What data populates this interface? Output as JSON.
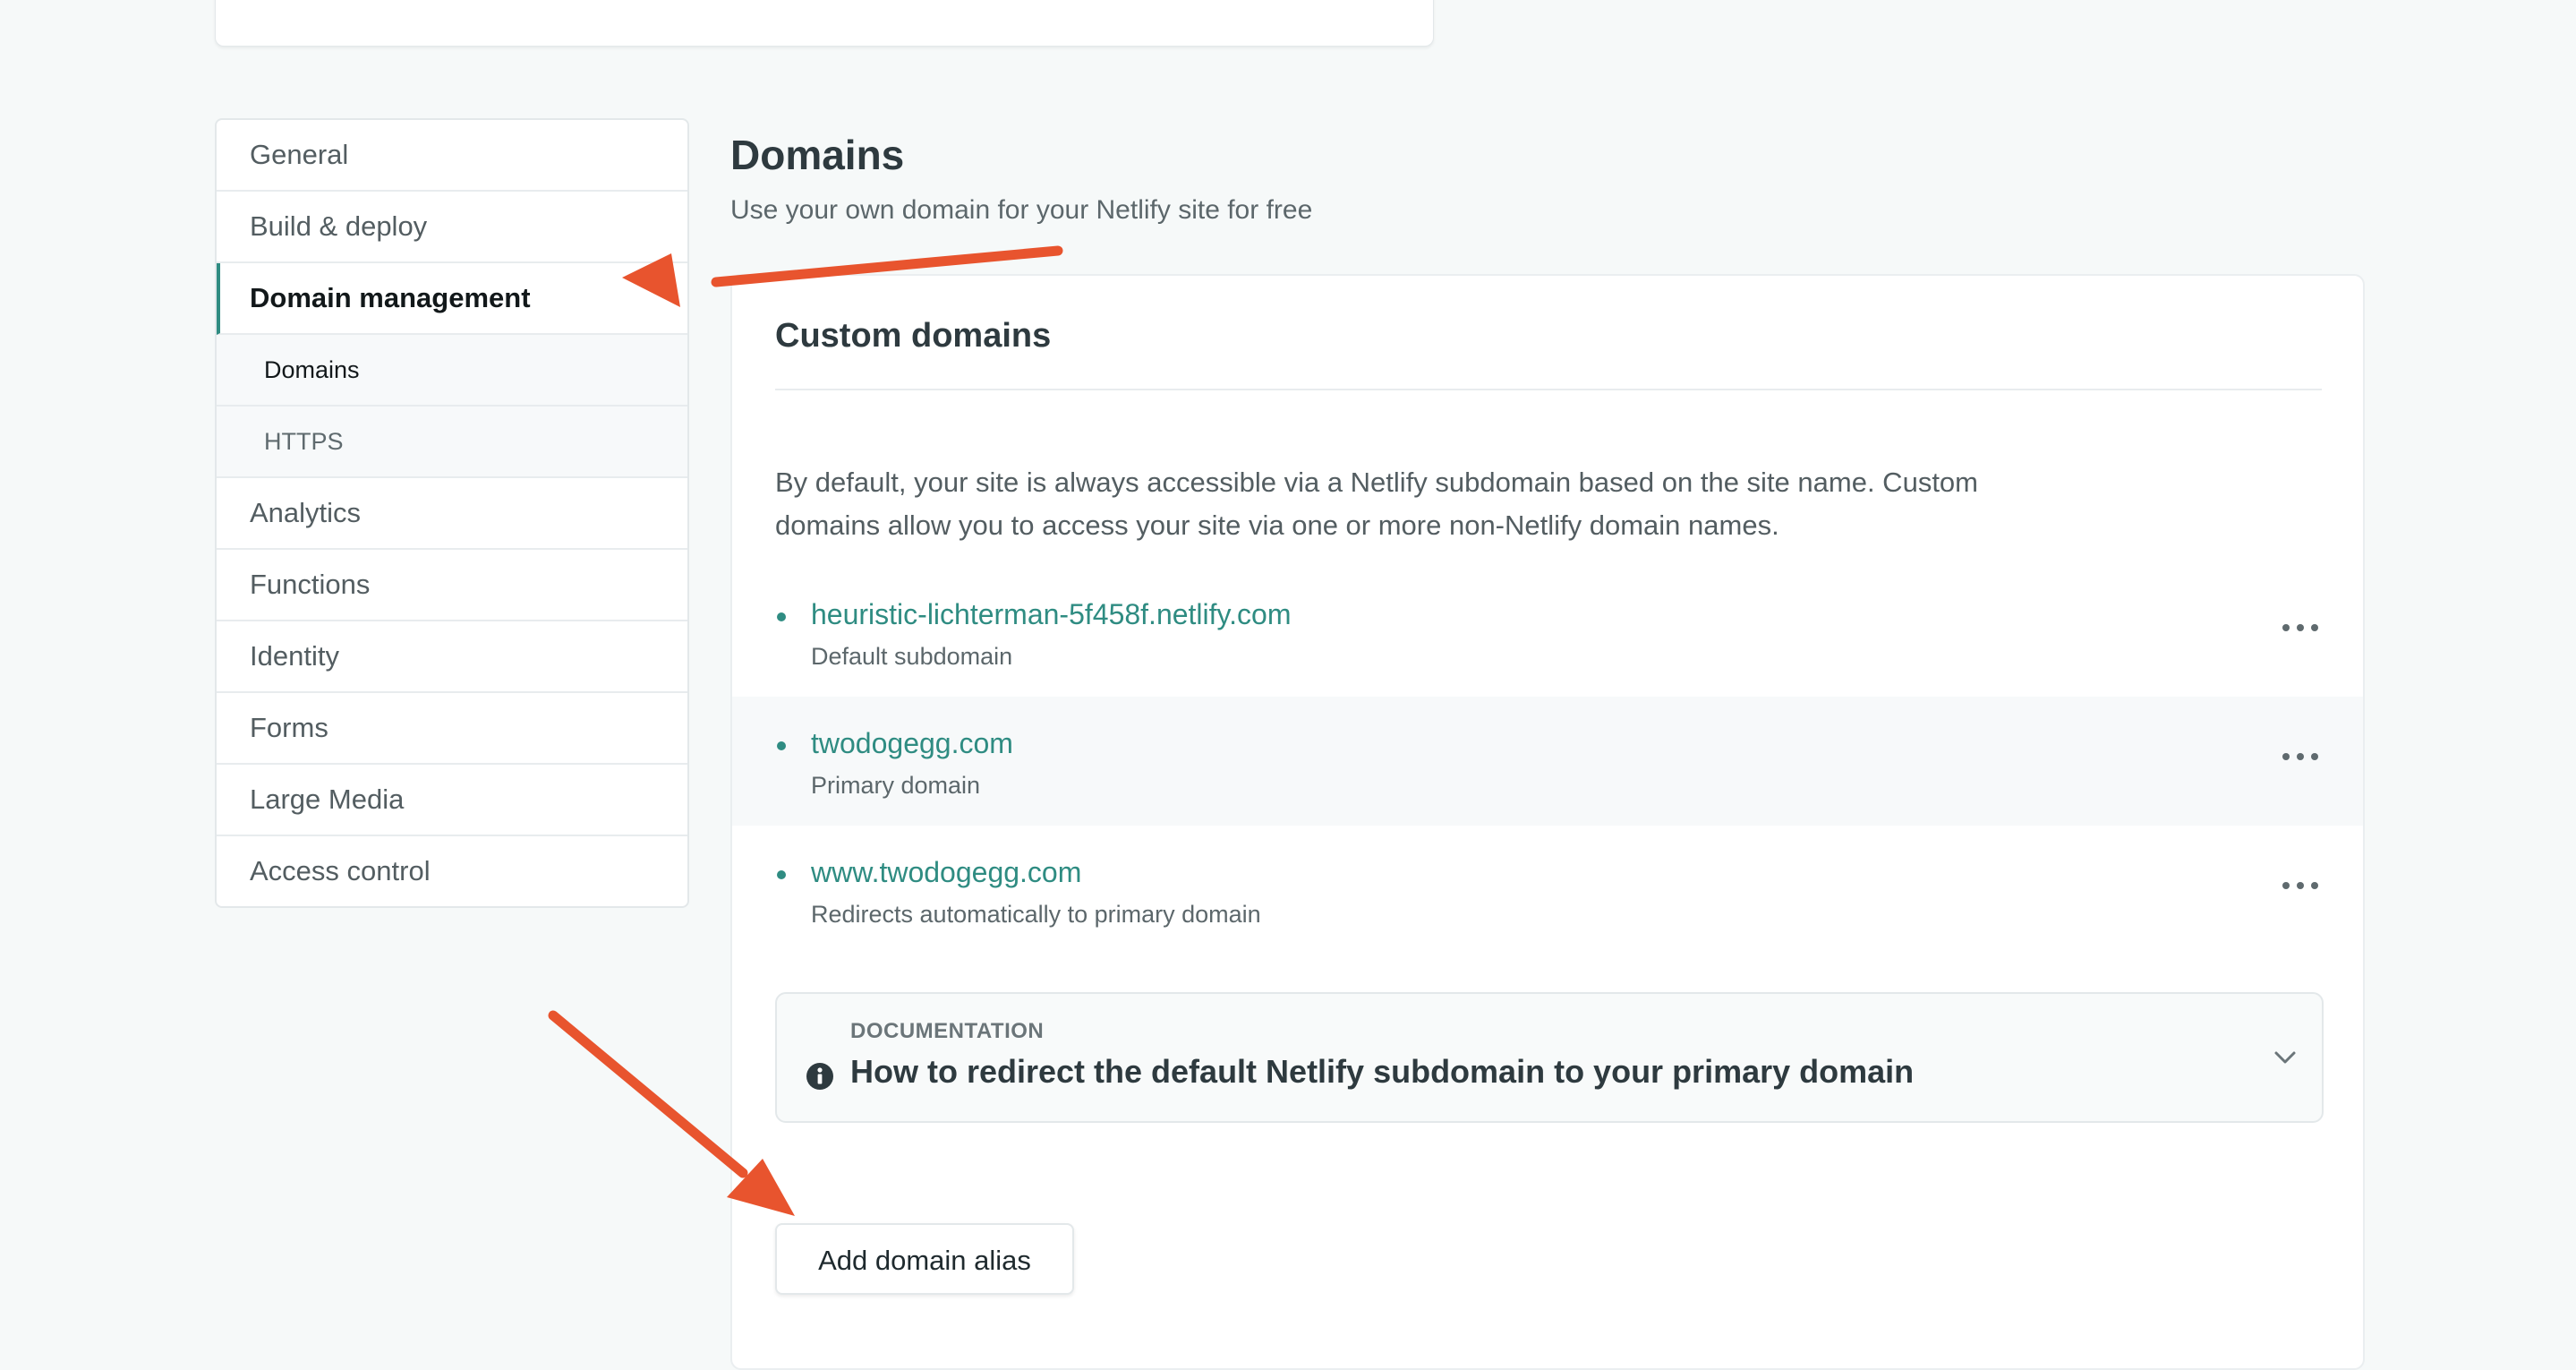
{
  "sidebar": {
    "items": [
      {
        "label": "General"
      },
      {
        "label": "Build & deploy"
      },
      {
        "label": "Domain management"
      },
      {
        "label": "Analytics"
      },
      {
        "label": "Functions"
      },
      {
        "label": "Identity"
      },
      {
        "label": "Forms"
      },
      {
        "label": "Large Media"
      },
      {
        "label": "Access control"
      }
    ],
    "subitems": [
      {
        "label": "Domains"
      },
      {
        "label": "HTTPS"
      }
    ]
  },
  "page": {
    "title": "Domains",
    "subtitle": "Use your own domain for your Netlify site for free"
  },
  "custom_domains": {
    "title": "Custom domains",
    "description": "By default, your site is always accessible via a Netlify subdomain based on the site name. Custom domains allow you to access your site via one or more non-Netlify domain names.",
    "domains": [
      {
        "name": "heuristic-lichterman-5f458f.netlify.com",
        "role": "Default subdomain"
      },
      {
        "name": "twodogegg.com",
        "role": "Primary domain"
      },
      {
        "name": "www.twodogegg.com",
        "role": "Redirects automatically to primary domain"
      }
    ],
    "documentation": {
      "label": "DOCUMENTATION",
      "title": "How to redirect the default Netlify subdomain to your primary domain"
    },
    "add_button": "Add domain alias"
  },
  "colors": {
    "accent": "#2f8c82",
    "annotation_arrow": "#e8542e"
  },
  "icons": {
    "more": "more-icon",
    "info": "info-icon",
    "chevron": "chevron-down-icon"
  }
}
